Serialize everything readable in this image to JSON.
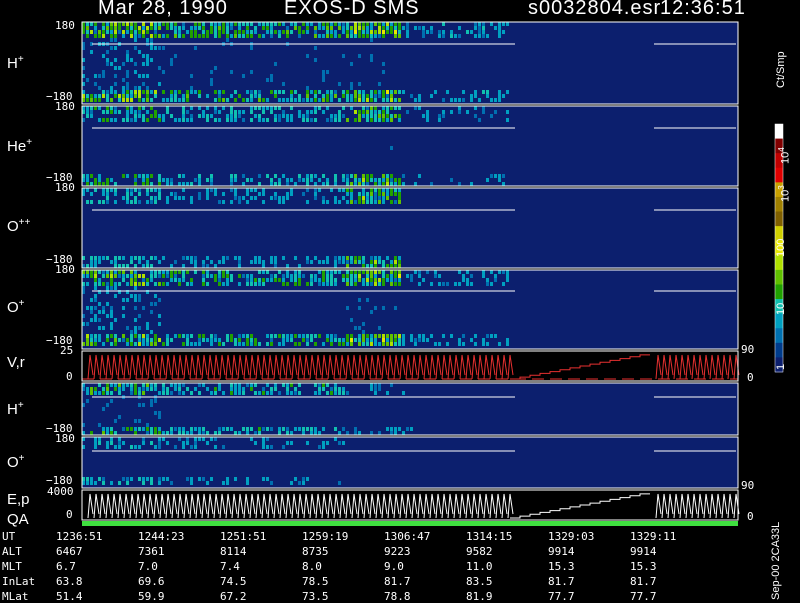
{
  "header": {
    "date": "Mar 28, 1990",
    "instrument": "EXOS-D SMS",
    "file": "s0032804.esr",
    "time": "12:36:51"
  },
  "colorbar": {
    "unit": "Ct/Smp",
    "labels": [
      "10^4",
      "10^3",
      "100",
      "10",
      "1"
    ],
    "colors": [
      "#ffffff",
      "#800000",
      "#c00000",
      "#e00000",
      "#c8a000",
      "#a08000",
      "#806000",
      "#d0d000",
      "#e8e800",
      "#b0e000",
      "#60c000",
      "#20a000",
      "#10c0b0",
      "#00a0c0",
      "#0070b0",
      "#003c8c",
      "#0c1f6e"
    ]
  },
  "panels": [
    {
      "label": "H",
      "sup": "+",
      "ymax": "180",
      "ymin": "−180"
    },
    {
      "label": "He",
      "sup": "+",
      "ymax": "180",
      "ymin": "−180"
    },
    {
      "label": "O",
      "sup": "++",
      "ymax": "180",
      "ymin": "−180"
    },
    {
      "label": "O",
      "sup": "+",
      "ymax": "180",
      "ymin": "−180"
    },
    {
      "label": "V,r",
      "sup": "",
      "ymax": "25",
      "ymin": "0",
      "rmax": "90",
      "rmin": "0"
    },
    {
      "label": "H",
      "sup": "+",
      "ymax": "180",
      "ymin": "−180"
    },
    {
      "label": "O",
      "sup": "+",
      "ymax": "180",
      "ymin": "−180"
    },
    {
      "label": "E,p",
      "sup": "",
      "label2": "QA",
      "ymax": "4000",
      "ymin": "0",
      "rmax": "90",
      "rmin": "0"
    }
  ],
  "footer_note": "Sep-00  2CA33L",
  "table": {
    "rows": [
      {
        "name": "UT",
        "values": [
          "1236:51",
          "1244:23",
          "1251:51",
          "1259:19",
          "1306:47",
          "1314:15",
          "1329:03",
          "1329:11"
        ]
      },
      {
        "name": "ALT",
        "values": [
          "6467",
          "7361",
          "8114",
          "8735",
          "9223",
          "9582",
          "9914",
          "9914"
        ]
      },
      {
        "name": "MLT",
        "values": [
          "6.7",
          "7.0",
          "7.4",
          "8.0",
          "9.0",
          "11.0",
          "15.3",
          "15.3"
        ]
      },
      {
        "name": "InLat",
        "values": [
          "63.8",
          "69.6",
          "74.5",
          "78.5",
          "81.7",
          "83.5",
          "81.7",
          "81.7"
        ]
      },
      {
        "name": "MLat",
        "values": [
          "51.4",
          "59.9",
          "67.2",
          "73.5",
          "78.8",
          "81.9",
          "77.7",
          "77.7"
        ]
      }
    ]
  },
  "chart_data": {
    "type": "heatmap",
    "title": "Mar 28, 1990   EXOS-D SMS",
    "x_ticks": [
      "1236:51",
      "1244:23",
      "1251:51",
      "1259:19",
      "1306:47",
      "1314:15",
      "1329:03",
      "1329:11"
    ],
    "color_scale": "log",
    "color_range": [
      1,
      10000
    ],
    "data_gap": "approx. 1314:15 to 1329:03"
  }
}
